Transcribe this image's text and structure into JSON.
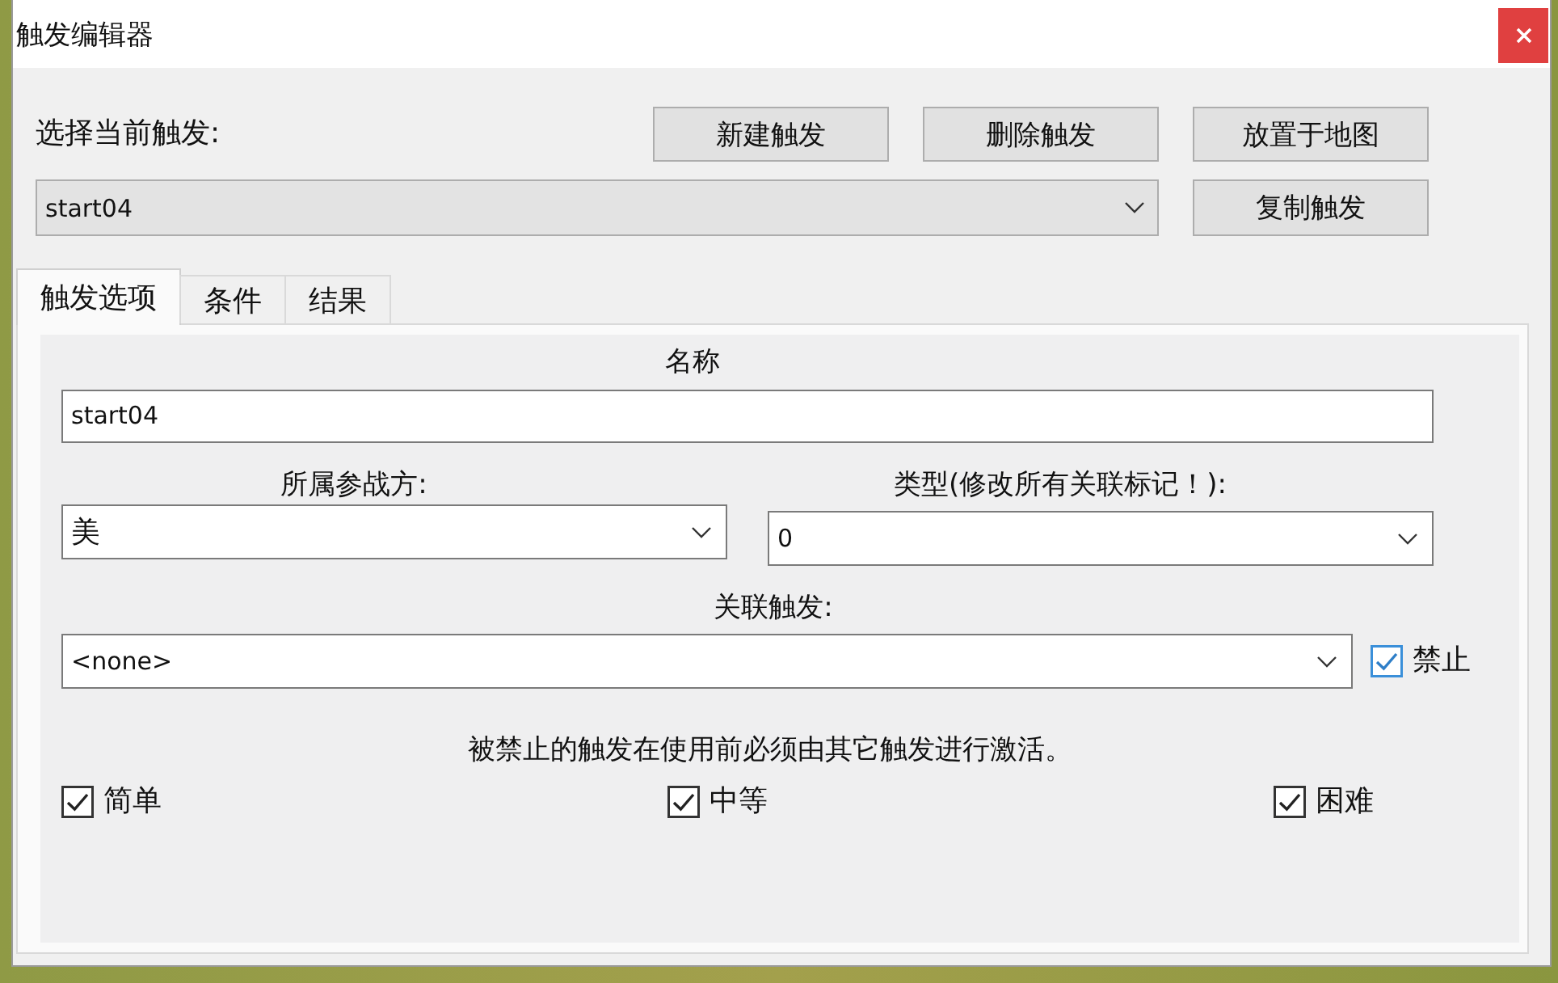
{
  "window": {
    "title": "触发编辑器"
  },
  "trigger_select": {
    "label": "选择当前触发:",
    "value": "start04"
  },
  "buttons": [
    {
      "label": "新建触发"
    },
    {
      "label": "删除触发"
    },
    {
      "label": "放置于地图"
    },
    {
      "label": "复制触发"
    }
  ],
  "tabs": [
    {
      "label": "触发选项",
      "selected": true
    },
    {
      "label": "条件",
      "selected": false
    },
    {
      "label": "结果",
      "selected": false
    }
  ],
  "options": {
    "name": {
      "label": "名称",
      "value": "start04"
    },
    "side": {
      "label": "所属参战方:",
      "value": "美"
    },
    "type": {
      "label": "类型(修改所有关联标记！):",
      "value": "0"
    },
    "linked": {
      "label": "关联触发:",
      "value": "<none>"
    },
    "disabled": {
      "label": "禁止",
      "checked": true
    },
    "note": "被禁止的触发在使用前必须由其它触发进行激活。",
    "difficulties": [
      {
        "label": "简单",
        "checked": true
      },
      {
        "label": "中等",
        "checked": true
      },
      {
        "label": "困难",
        "checked": true
      }
    ]
  }
}
